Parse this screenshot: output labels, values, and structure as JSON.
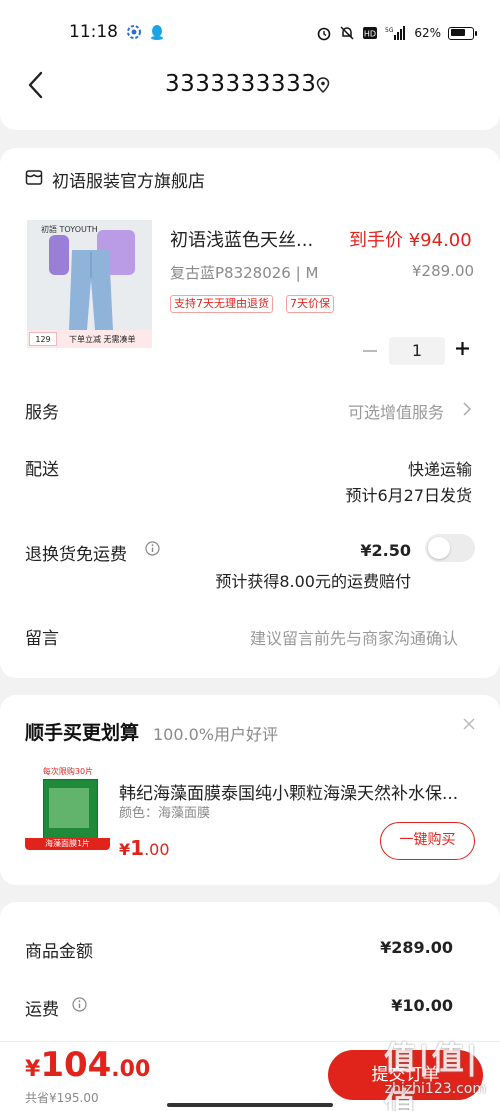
{
  "status_bar": {
    "time": "11:18",
    "battery": "62%",
    "network": "5G"
  },
  "header": {
    "phone_number": "3333333333"
  },
  "store": {
    "name": "初语服装官方旗舰店"
  },
  "product": {
    "title": "初语浅蓝色天丝...",
    "deal_price_label": "到手价 ¥94.00",
    "variant": "复古蓝P8328026 | M",
    "original_price": "¥289.00",
    "tags": [
      "支持7天无理由退货",
      "7天价保"
    ],
    "quantity": "1",
    "thumb_brand": "初語 TOYOUTH",
    "thumb_price": "129",
    "thumb_promo": "下单立减 无需凑单"
  },
  "rows": {
    "service_label": "服务",
    "service_value": "可选增值服务",
    "delivery_label": "配送",
    "delivery_method": "快递运输",
    "delivery_eta": "预计6月27日发货",
    "return_label": "退换货免运费",
    "return_price": "¥2.50",
    "return_note": "预计获得8.00元的运费赔付",
    "message_label": "留言",
    "message_placeholder": "建议留言前先与商家沟通确认"
  },
  "recommend": {
    "title": "顺手买更划算",
    "rating": "100.0%用户好评",
    "thumb_badge": "每次限购30片",
    "thumb_foot": "海藻面膜1片",
    "item_name": "韩纪海藻面膜泰国纯小颗粒海澡天然补水保...",
    "item_color": "颜色：海藻面膜",
    "price_currency": "¥",
    "price_int": "1",
    "price_dec": ".00",
    "buy_label": "一键购买"
  },
  "summary": {
    "goods_label": "商品金额",
    "goods_value": "¥289.00",
    "shipping_label": "运费",
    "shipping_value": "¥10.00"
  },
  "bottom": {
    "total_currency": "¥",
    "total_int": "104",
    "total_dec": ".00",
    "savings": "共省¥195.00",
    "submit_label": "提交订单",
    "watermark_main": "值|值|值",
    "watermark_url": "zhizhi123.com"
  },
  "colors": {
    "accent": "#e0241b",
    "background": "#f2f2f2"
  }
}
